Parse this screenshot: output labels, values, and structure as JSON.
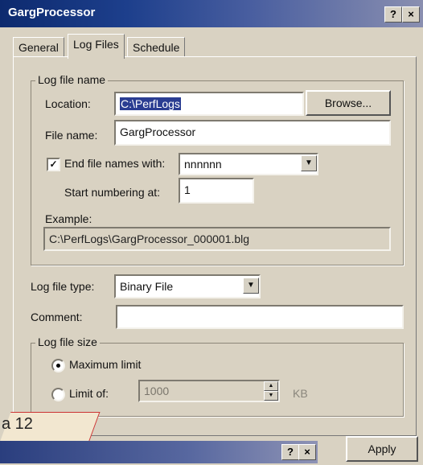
{
  "window": {
    "title": "GargProcessor",
    "help_label": "?",
    "close_label": "×"
  },
  "tabs": [
    {
      "label": "General"
    },
    {
      "label": "Log Files"
    },
    {
      "label": "Schedule"
    }
  ],
  "log_file_name": {
    "legend": "Log file name",
    "location_label": "Location:",
    "location_value": "C:\\PerfLogs",
    "browse_label": "Browse...",
    "file_name_label": "File name:",
    "file_name_value": "GargProcessor",
    "end_names_label": "End file names with:",
    "end_names_checked": true,
    "end_names_value": "nnnnnn",
    "start_numbering_label": "Start numbering at:",
    "start_numbering_value": "1",
    "example_label": "Example:",
    "example_value": "C:\\PerfLogs\\GargProcessor_000001.blg"
  },
  "log_file_type": {
    "label": "Log file type:",
    "value": "Binary File"
  },
  "comment": {
    "label": "Comment:",
    "value": ""
  },
  "log_file_size": {
    "legend": "Log file size",
    "max_label": "Maximum limit",
    "max_selected": true,
    "limit_label": "Limit of:",
    "limit_value": "1000",
    "unit": "KB"
  },
  "footer": {
    "caption": "a 12",
    "apply_label": "Apply",
    "second_window_help": "?",
    "second_window_close": "×"
  }
}
